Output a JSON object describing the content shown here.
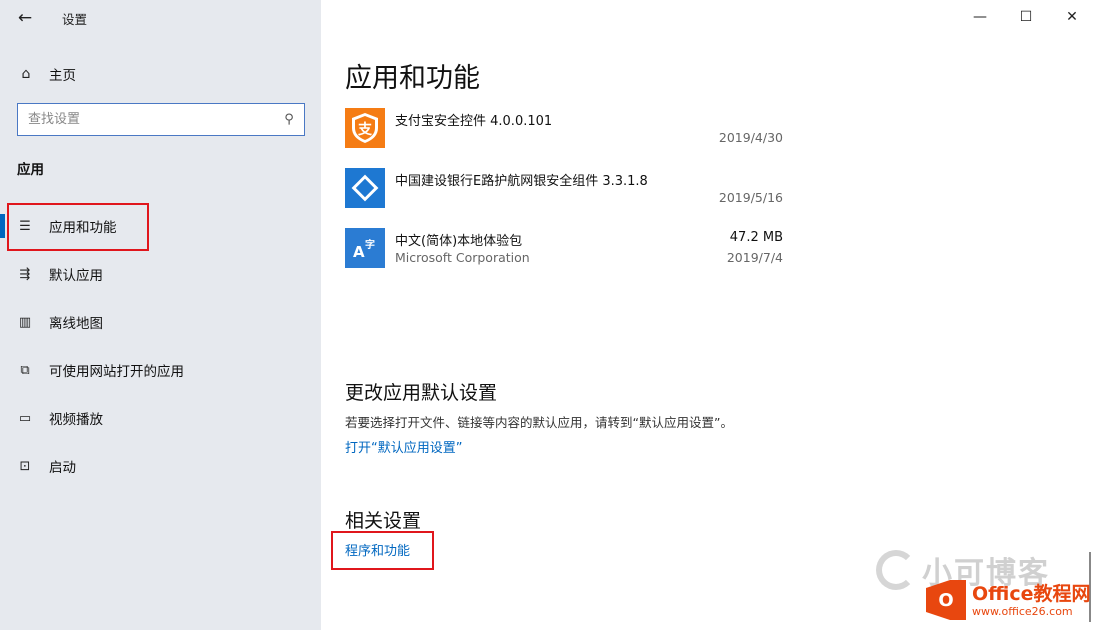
{
  "window": {
    "title": "设置",
    "controls": {
      "minimize": "—",
      "maximize": "☐",
      "close": "✕"
    }
  },
  "sidebar": {
    "back_icon": "←",
    "home": {
      "icon": "home-icon",
      "label": "主页"
    },
    "search": {
      "placeholder": "查找设置"
    },
    "section": "应用",
    "items": [
      {
        "icon": "list-icon",
        "label": "应用和功能",
        "active": true
      },
      {
        "icon": "default-apps-icon",
        "label": "默认应用"
      },
      {
        "icon": "map-icon",
        "label": "离线地图"
      },
      {
        "icon": "web-open-icon",
        "label": "可使用网站打开的应用"
      },
      {
        "icon": "video-icon",
        "label": "视频播放"
      },
      {
        "icon": "startup-icon",
        "label": "启动"
      }
    ]
  },
  "main": {
    "title": "应用和功能",
    "apps": [
      {
        "name": "支付宝安全控件 4.0.0.101",
        "publisher": "",
        "size": "",
        "date": "2019/4/30",
        "icon_color": "#f57c14",
        "icon_glyph": "支"
      },
      {
        "name": "中国建设银行E路护航网银安全组件 3.3.1.8",
        "publisher": "",
        "size": "",
        "date": "2019/5/16",
        "icon_color": "#1e78d2",
        "icon_glyph": "◇"
      },
      {
        "name": "中文(简体)本地体验包",
        "publisher": "Microsoft Corporation",
        "size": "47.2 MB",
        "date": "2019/7/4",
        "icon_color": "#2b7cd3",
        "icon_glyph": "A字"
      }
    ],
    "default_section": {
      "heading": "更改应用默认设置",
      "description": "若要选择打开文件、链接等内容的默认应用，请转到“默认应用设置”。",
      "link": "打开“默认应用设置”"
    },
    "related": {
      "heading": "相关设置",
      "link": "程序和功能"
    }
  },
  "watermarks": {
    "xiaoke": "小可博客",
    "office_logo": "O",
    "office_title_a": "Office",
    "office_title_b": "教程网",
    "office_url": "www.office26.com"
  }
}
